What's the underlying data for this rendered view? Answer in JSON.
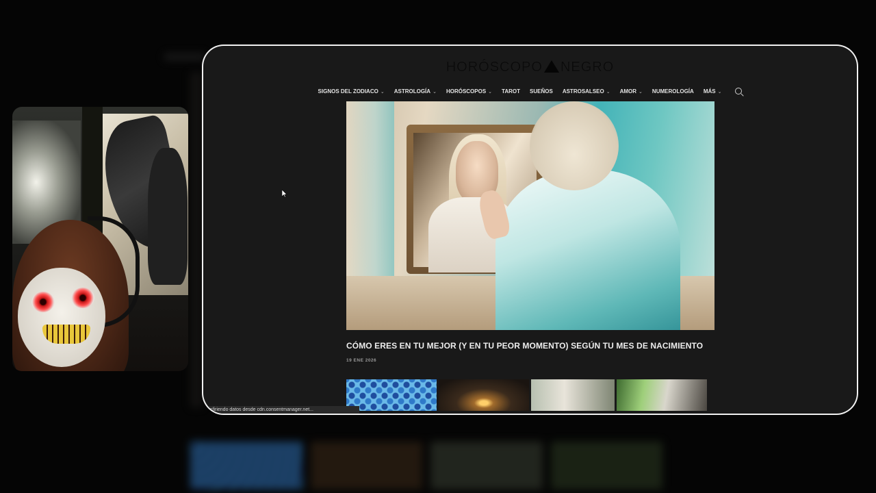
{
  "site": {
    "logo_left": "HORÓSCOPO",
    "logo_right": "NEGRO"
  },
  "nav": {
    "items": [
      {
        "label": "SIGNOS DEL ZODIACO",
        "has_dropdown": true
      },
      {
        "label": "ASTROLOGÍA",
        "has_dropdown": true
      },
      {
        "label": "HORÓSCOPOS",
        "has_dropdown": true
      },
      {
        "label": "TAROT",
        "has_dropdown": false
      },
      {
        "label": "SUEÑOS",
        "has_dropdown": false
      },
      {
        "label": "ASTROSALSEO",
        "has_dropdown": true
      },
      {
        "label": "AMOR",
        "has_dropdown": true
      },
      {
        "label": "NUMEROLOGÍA",
        "has_dropdown": false
      },
      {
        "label": "MÁS",
        "has_dropdown": true
      }
    ],
    "chevron": "⌄",
    "search_icon": "search-icon"
  },
  "post": {
    "title": "CÓMO ERES EN TU MEJOR (Y EN TU PEOR MOMENTO) SEGÚN TU MES DE NACIMIENTO",
    "date": "19 ENE 2026"
  },
  "status_bar": {
    "text": "sfiriendo datos desde cdn.consentmanager.net..."
  },
  "colors": {
    "page_bg": "#191919",
    "nav_text": "#e3e3e3",
    "frame_border": "#f2f2f2"
  }
}
